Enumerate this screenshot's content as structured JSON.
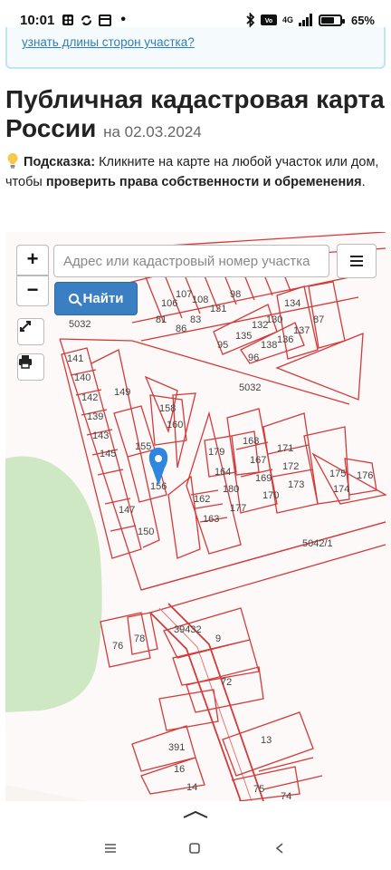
{
  "status_bar": {
    "time": "10:01",
    "network": "4G",
    "battery": "65%"
  },
  "info_box": {
    "link_text": "узнать длины сторон участка?"
  },
  "page": {
    "title": "Публичная кадастровая карта России",
    "date_prefix": "на",
    "date": "02.03.2024"
  },
  "hint": {
    "icon": "lightbulb-icon",
    "label": "Подсказка:",
    "text_1": "Кликните на карте на любой участок или дом, чтобы",
    "text_bold": "проверить права собственности и обременения",
    "text_end": "."
  },
  "map_controls": {
    "zoom_in": "+",
    "zoom_out": "−",
    "search_placeholder": "Адрес или кадастровый номер участка",
    "find_label": "Найти"
  },
  "map": {
    "parcel_labels": [
      "5032",
      "5032",
      "5042/1",
      "141",
      "140",
      "142",
      "139",
      "143",
      "145",
      "149",
      "155",
      "158",
      "160",
      "156",
      "147",
      "150",
      "179",
      "164",
      "162",
      "163",
      "180",
      "177",
      "168",
      "167",
      "169",
      "170",
      "171",
      "172",
      "173",
      "175",
      "174",
      "176",
      "81",
      "86",
      "83",
      "95",
      "96",
      "135",
      "132",
      "130",
      "138",
      "136",
      "134",
      "137",
      "87",
      "98",
      "107",
      "106",
      "108",
      "131",
      "39432",
      "9",
      "72",
      "391",
      "16",
      "14",
      "13",
      "75",
      "74",
      "76",
      "78"
    ],
    "parcel_color": "#d33a3a",
    "forest_color": "#cfe8c4",
    "marker_color": "#2e86de"
  }
}
